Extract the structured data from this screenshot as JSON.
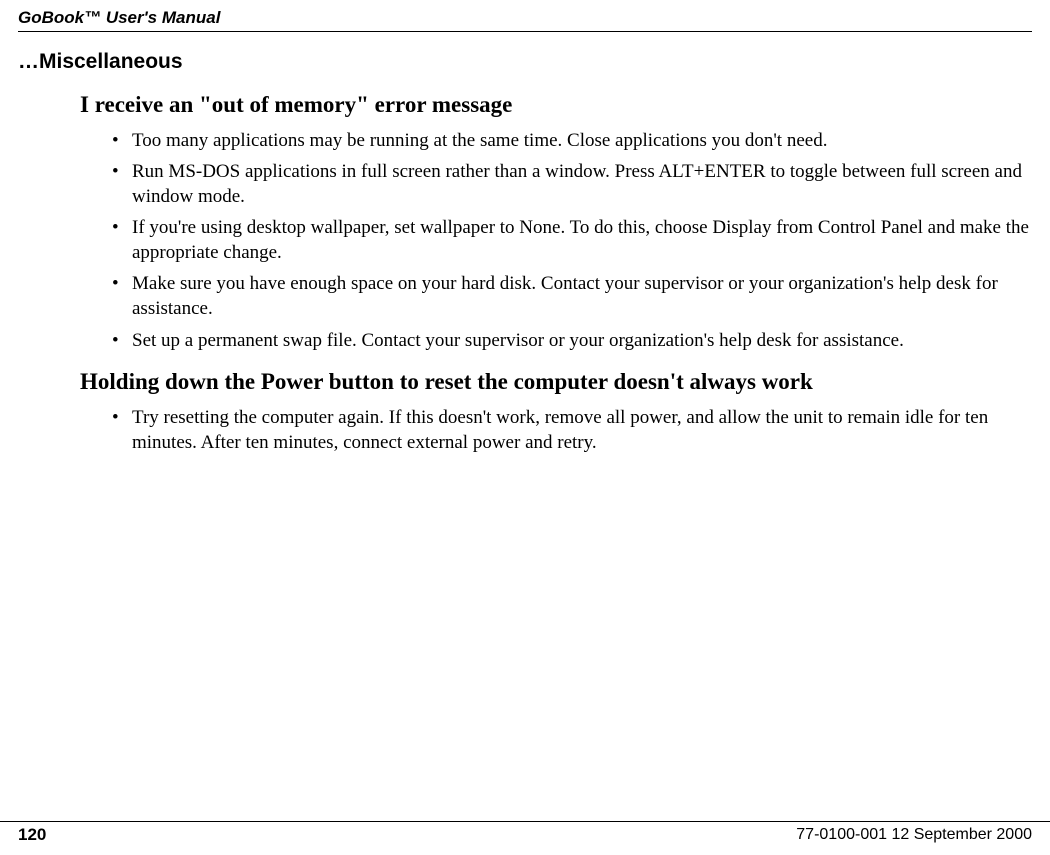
{
  "header": {
    "title": "GoBook™ User's Manual"
  },
  "section": {
    "title": "…Miscellaneous"
  },
  "blocks": [
    {
      "heading": "I receive an \"out of memory\" error message",
      "bullets": [
        "Too many applications may be running at the same time. Close applications you don't need.",
        "Run MS-DOS applications in full screen rather than a window. Press ALT+ENTER to toggle between full screen and window mode.",
        "If you're using desktop wallpaper, set wallpaper to None. To do this, choose Display from Control Panel and make the appropriate change.",
        "Make sure you have enough space on your hard disk. Contact your supervisor or your organization's help desk for assistance.",
        "Set up a permanent swap file. Contact your supervisor or your organization's help desk for assistance."
      ]
    },
    {
      "heading": "Holding down the Power button to reset the computer doesn't always work",
      "bullets": [
        "Try resetting the computer again. If this doesn't work, remove all power, and allow the unit to remain idle for ten minutes. After ten minutes, connect external power and retry."
      ]
    }
  ],
  "footer": {
    "page": "120",
    "docRef": "77-0100-001   12 September 2000"
  }
}
